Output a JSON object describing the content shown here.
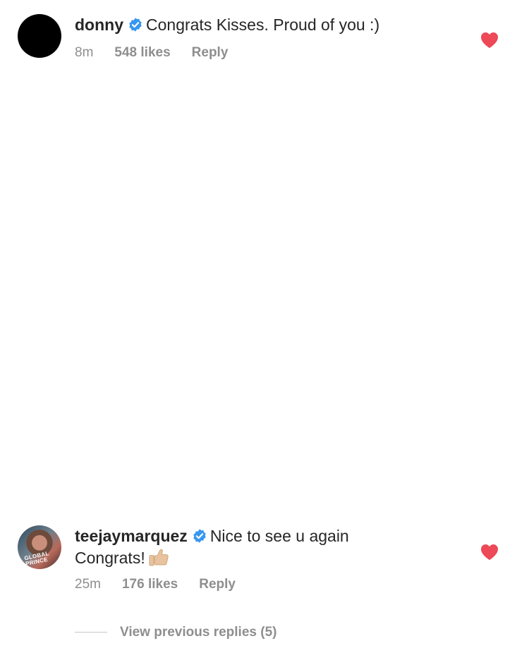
{
  "comments": [
    {
      "username": "donny",
      "text": "Congrats Kisses. Proud of you :)",
      "time": "8m",
      "likes": "548 likes",
      "reply": "Reply",
      "verified": true,
      "liked": true,
      "avatar": "black-circle"
    },
    {
      "username": "teejaymarquez",
      "text": "Nice to see u again",
      "text_line2": "Congrats!",
      "time": "25m",
      "likes": "176 likes",
      "reply": "Reply",
      "verified": true,
      "liked": true,
      "avatar": "profile-photo",
      "avatar_caption": "GLOBAL PRINCE",
      "emoji": "thumbs-up-icon"
    }
  ],
  "view_previous_replies": "View previous replies (5)",
  "colors": {
    "verified_blue": "#3897f0",
    "heart_red": "#ed4956",
    "meta_gray": "#8e8e8e",
    "text": "#262626"
  }
}
